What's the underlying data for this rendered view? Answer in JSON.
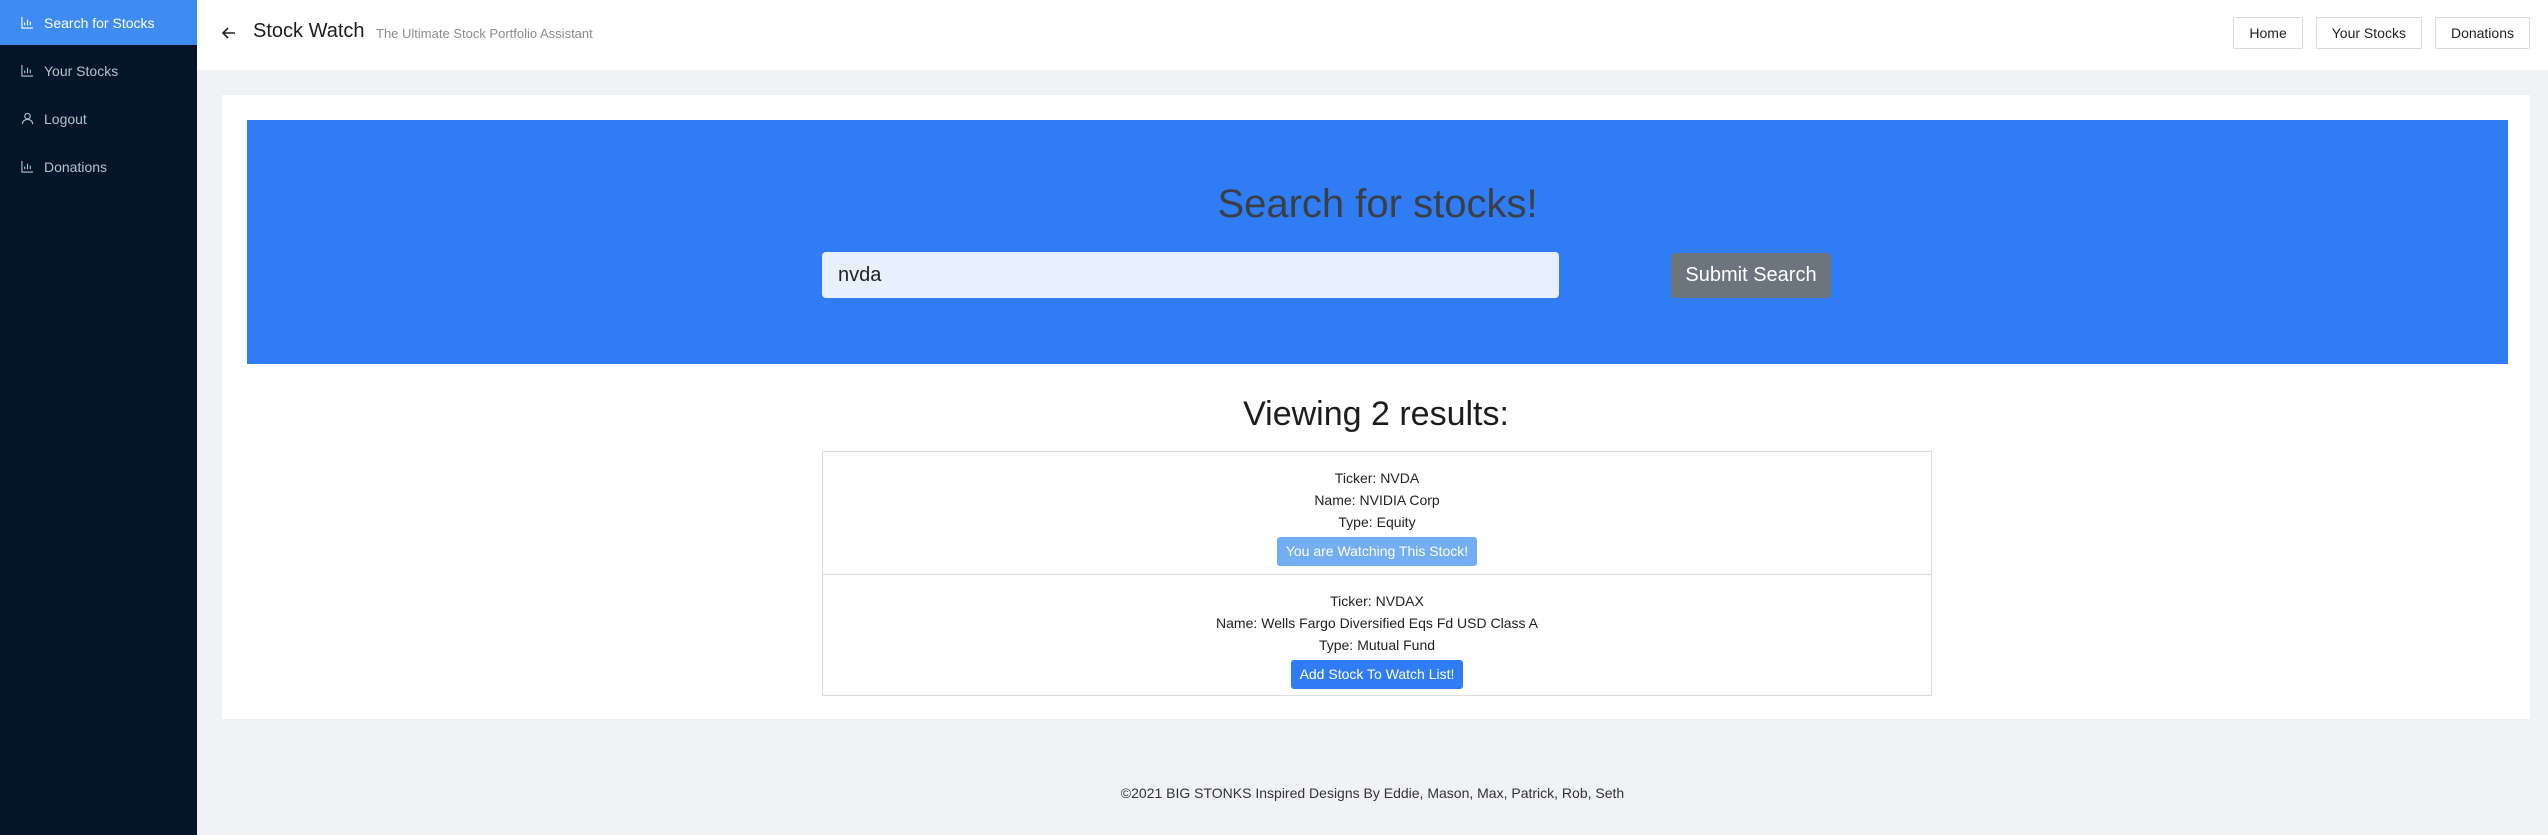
{
  "sidebar": {
    "items": [
      {
        "label": "Search for Stocks",
        "icon": "bar-chart-icon"
      },
      {
        "label": "Your Stocks",
        "icon": "bar-chart-icon"
      },
      {
        "label": "Logout",
        "icon": "user-icon"
      },
      {
        "label": "Donations",
        "icon": "bar-chart-icon"
      }
    ]
  },
  "header": {
    "title": "Stock Watch",
    "subtitle": "The Ultimate Stock Portfolio Assistant",
    "nav": [
      "Home",
      "Your Stocks",
      "Donations"
    ]
  },
  "hero": {
    "title": "Search for stocks!",
    "input_value": "nvda",
    "submit_label": "Submit Search"
  },
  "results": {
    "heading": "Viewing 2 results:",
    "ticker_label": "Ticker:",
    "name_label": "Name:",
    "type_label": "Type:",
    "items": [
      {
        "ticker": "NVDA",
        "name": "NVIDIA Corp",
        "type": "Equity",
        "button": "You are Watching This Stock!"
      },
      {
        "ticker": "NVDAX",
        "name": "Wells Fargo Diversified Eqs Fd USD Class A",
        "type": "Mutual Fund",
        "button": "Add Stock To Watch List!"
      }
    ]
  },
  "footer": {
    "text": "©2021 BIG STONKS Inspired Designs By Eddie, Mason, Max, Patrick, Rob, Seth"
  },
  "colors": {
    "sidebar_bg": "#031528",
    "accent": "#3e8bf2",
    "hero_bg": "#2f7cf5",
    "submit_bg": "#6c757d",
    "watching_bg": "#74aef2"
  }
}
